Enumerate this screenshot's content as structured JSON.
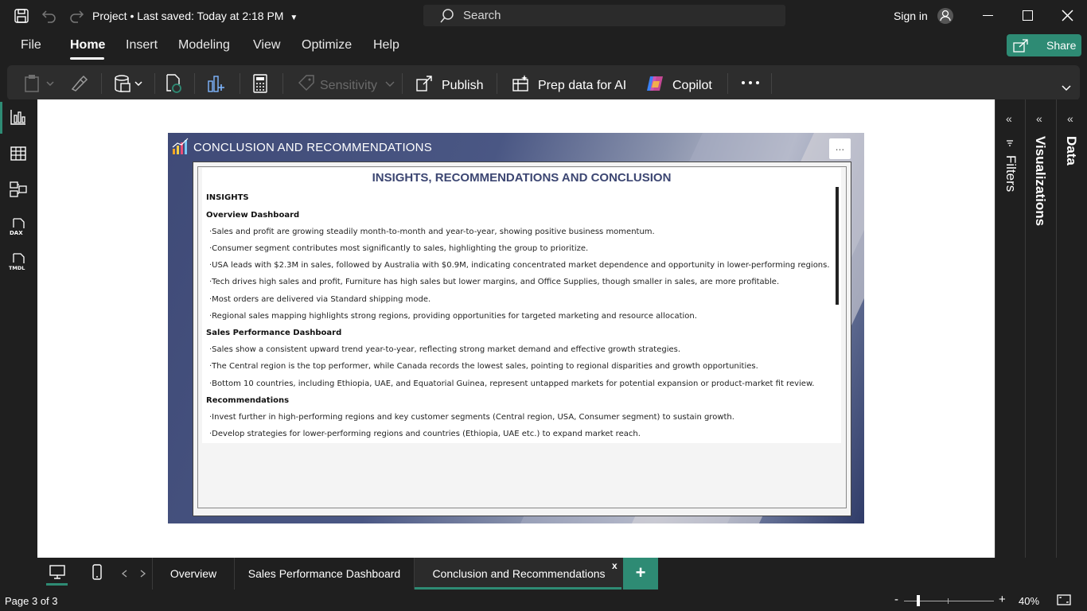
{
  "titlebar": {
    "title": "Project",
    "separator": "•",
    "saved": "Last saved: Today at 2:18 PM",
    "search_placeholder": "Search",
    "signin": "Sign in"
  },
  "menu": {
    "items": [
      "File",
      "Home",
      "Insert",
      "Modeling",
      "View",
      "Optimize",
      "Help"
    ],
    "active": "Home",
    "share": "Share"
  },
  "ribbon": {
    "sensitivity": "Sensitivity",
    "publish": "Publish",
    "prep_data": "Prep data for AI",
    "copilot": "Copilot",
    "more": "..."
  },
  "report": {
    "header": "CONCLUSION AND RECOMMENDATIONS",
    "more_button": "...",
    "doc_title": "INSIGHTS, RECOMMENDATIONS AND CONCLUSION",
    "lines": [
      {
        "type": "head",
        "text": "INSIGHTS"
      },
      {
        "type": "head",
        "text": "Overview Dashboard"
      },
      {
        "type": "bullet",
        "text": "·Sales and profit are growing steadily month-to-month and year-to-year, showing positive business momentum."
      },
      {
        "type": "bullet",
        "text": "·Consumer segment contributes most significantly to sales, highlighting the group to prioritize."
      },
      {
        "type": "bullet",
        "text": "·USA leads with $2.3M in sales, followed by Australia with $0.9M, indicating concentrated market dependence and opportunity in lower-performing regions."
      },
      {
        "type": "bullet",
        "text": "·Tech drives high sales and profit, Furniture has high sales but lower margins, and Office Supplies, though smaller in sales, are more profitable."
      },
      {
        "type": "bullet",
        "text": "·Most orders are delivered via Standard shipping mode."
      },
      {
        "type": "bullet",
        "text": "·Regional sales mapping highlights strong regions, providing opportunities for targeted marketing and resource allocation."
      },
      {
        "type": "head",
        "text": "Sales Performance Dashboard"
      },
      {
        "type": "bullet",
        "text": "·Sales show a consistent upward trend year-to-year, reflecting strong market demand and effective growth strategies."
      },
      {
        "type": "bullet",
        "text": "·The Central region is the top performer, while Canada records the lowest sales, pointing to regional disparities and growth opportunities."
      },
      {
        "type": "bullet",
        "text": "·Bottom 10 countries, including Ethiopia, UAE, and Equatorial Guinea, represent untapped markets for potential expansion or product-market fit review."
      },
      {
        "type": "head",
        "text": "Recommendations"
      },
      {
        "type": "bullet",
        "text": "·Invest further in high-performing regions and key customer segments (Central region, USA, Consumer segment) to sustain growth."
      },
      {
        "type": "bullet",
        "text": "·Develop strategies for lower-performing regions and countries (Ethiopia, UAE etc.) to expand market reach."
      }
    ]
  },
  "panes": {
    "filters": "Filters",
    "visualizations": "Visualizations",
    "data": "Data"
  },
  "tabs": {
    "pages": [
      "Overview",
      "Sales Performance Dashboard",
      "Conclusion and Recommendations"
    ],
    "active_index": 2,
    "close": "x",
    "add": "+"
  },
  "status": {
    "page": "Page 3 of 3",
    "zoom": "40%",
    "zoom_minus": "-",
    "zoom_plus": "+"
  },
  "colors": {
    "accent": "#2e8b74",
    "doc_title": "#3c4672",
    "chrome_bg": "#1f1f1f"
  }
}
